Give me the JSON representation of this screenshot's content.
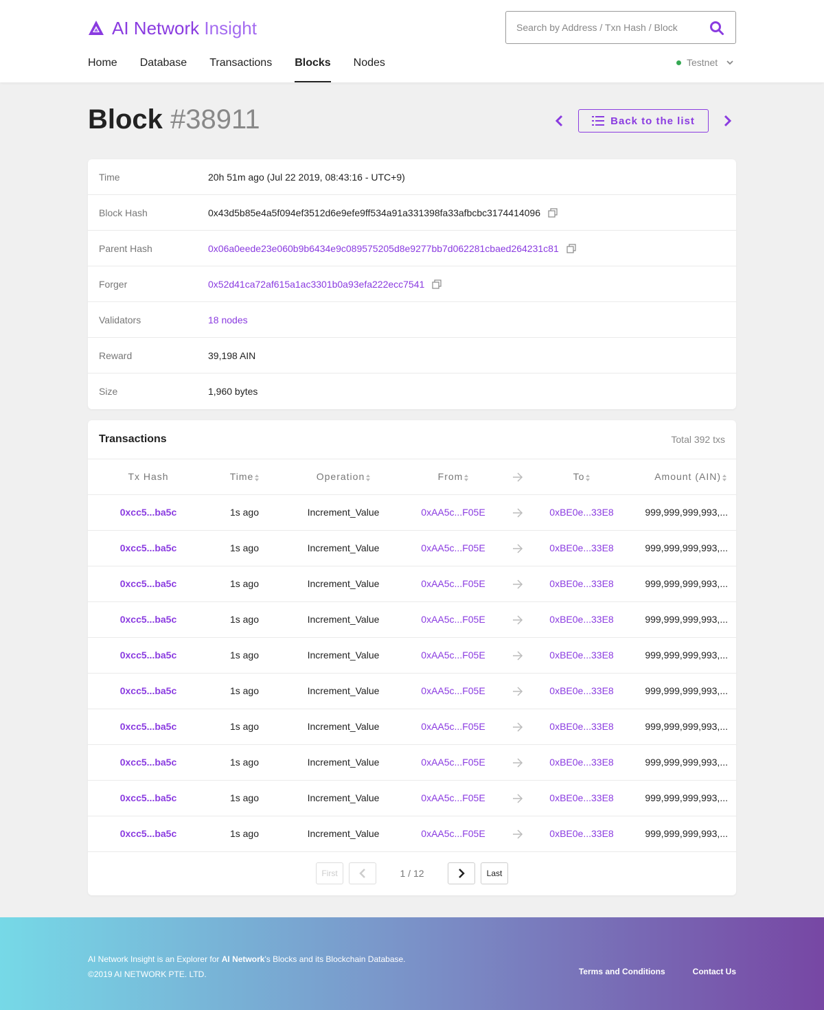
{
  "header": {
    "logo_name": "AI Network",
    "logo_suffix": "Insight",
    "search_placeholder": "Search by Address / Txn Hash / Block",
    "nav": [
      "Home",
      "Database",
      "Transactions",
      "Blocks",
      "Nodes"
    ],
    "active_nav": "Blocks",
    "network": "Testnet",
    "network_status_color": "#35a853"
  },
  "page": {
    "title_word": "Block",
    "block_number": "#38911",
    "back_label": "Back to the list"
  },
  "details": [
    {
      "label": "Time",
      "value": "20h 51m ago (Jul 22 2019, 08:43:16 - UTC+9)"
    },
    {
      "label": "Block Hash",
      "value": "0x43d5b85e4a5f094ef3512d6e9efe9ff534a91a331398fa33afbcbc3174414096"
    },
    {
      "label": "Parent Hash",
      "value": "0x06a0eede23e060b9b6434e9c089575205d8e9277bb7d062281cbaed264231c81"
    },
    {
      "label": "Forger",
      "value": "0x52d41ca72af615a1ac3301b0a93efa222ecc7541"
    },
    {
      "label": "Validators",
      "value": "18 nodes"
    },
    {
      "label": "Reward",
      "value": "39,198 AIN"
    },
    {
      "label": "Size",
      "value": "1,960 bytes"
    }
  ],
  "transactions": {
    "title": "Transactions",
    "total": "Total 392 txs",
    "columns": [
      "Tx Hash",
      "Time",
      "Operation",
      "From",
      "To",
      "Amount (AIN)"
    ],
    "rows": [
      {
        "hash": "0xcc5...ba5c",
        "time": "1s ago",
        "operation": "Increment_Value",
        "from": "0xAA5c...F05E",
        "to": "0xBE0e...33E8",
        "amount": "999,999,999,993,..."
      },
      {
        "hash": "0xcc5...ba5c",
        "time": "1s ago",
        "operation": "Increment_Value",
        "from": "0xAA5c...F05E",
        "to": "0xBE0e...33E8",
        "amount": "999,999,999,993,..."
      },
      {
        "hash": "0xcc5...ba5c",
        "time": "1s ago",
        "operation": "Increment_Value",
        "from": "0xAA5c...F05E",
        "to": "0xBE0e...33E8",
        "amount": "999,999,999,993,..."
      },
      {
        "hash": "0xcc5...ba5c",
        "time": "1s ago",
        "operation": "Increment_Value",
        "from": "0xAA5c...F05E",
        "to": "0xBE0e...33E8",
        "amount": "999,999,999,993,..."
      },
      {
        "hash": "0xcc5...ba5c",
        "time": "1s ago",
        "operation": "Increment_Value",
        "from": "0xAA5c...F05E",
        "to": "0xBE0e...33E8",
        "amount": "999,999,999,993,..."
      },
      {
        "hash": "0xcc5...ba5c",
        "time": "1s ago",
        "operation": "Increment_Value",
        "from": "0xAA5c...F05E",
        "to": "0xBE0e...33E8",
        "amount": "999,999,999,993,..."
      },
      {
        "hash": "0xcc5...ba5c",
        "time": "1s ago",
        "operation": "Increment_Value",
        "from": "0xAA5c...F05E",
        "to": "0xBE0e...33E8",
        "amount": "999,999,999,993,..."
      },
      {
        "hash": "0xcc5...ba5c",
        "time": "1s ago",
        "operation": "Increment_Value",
        "from": "0xAA5c...F05E",
        "to": "0xBE0e...33E8",
        "amount": "999,999,999,993,..."
      },
      {
        "hash": "0xcc5...ba5c",
        "time": "1s ago",
        "operation": "Increment_Value",
        "from": "0xAA5c...F05E",
        "to": "0xBE0e...33E8",
        "amount": "999,999,999,993,..."
      },
      {
        "hash": "0xcc5...ba5c",
        "time": "1s ago",
        "operation": "Increment_Value",
        "from": "0xAA5c...F05E",
        "to": "0xBE0e...33E8",
        "amount": "999,999,999,993,..."
      }
    ],
    "pager": {
      "first": "First",
      "last": "Last",
      "info": "1 / 12"
    }
  },
  "footer": {
    "line1_pre": "AI Network Insight is an Explorer for ",
    "line1_bold": "AI Network",
    "line1_post": "'s Blocks and its Blockchain Database.",
    "line2": "©2019 AI NETWORK PTE. LTD.",
    "links": [
      "Terms and Conditions",
      "Contact Us"
    ]
  },
  "colors": {
    "accent": "#8a3be0",
    "text": "#222222",
    "muted": "#777777",
    "background": "#f0f0f0"
  }
}
